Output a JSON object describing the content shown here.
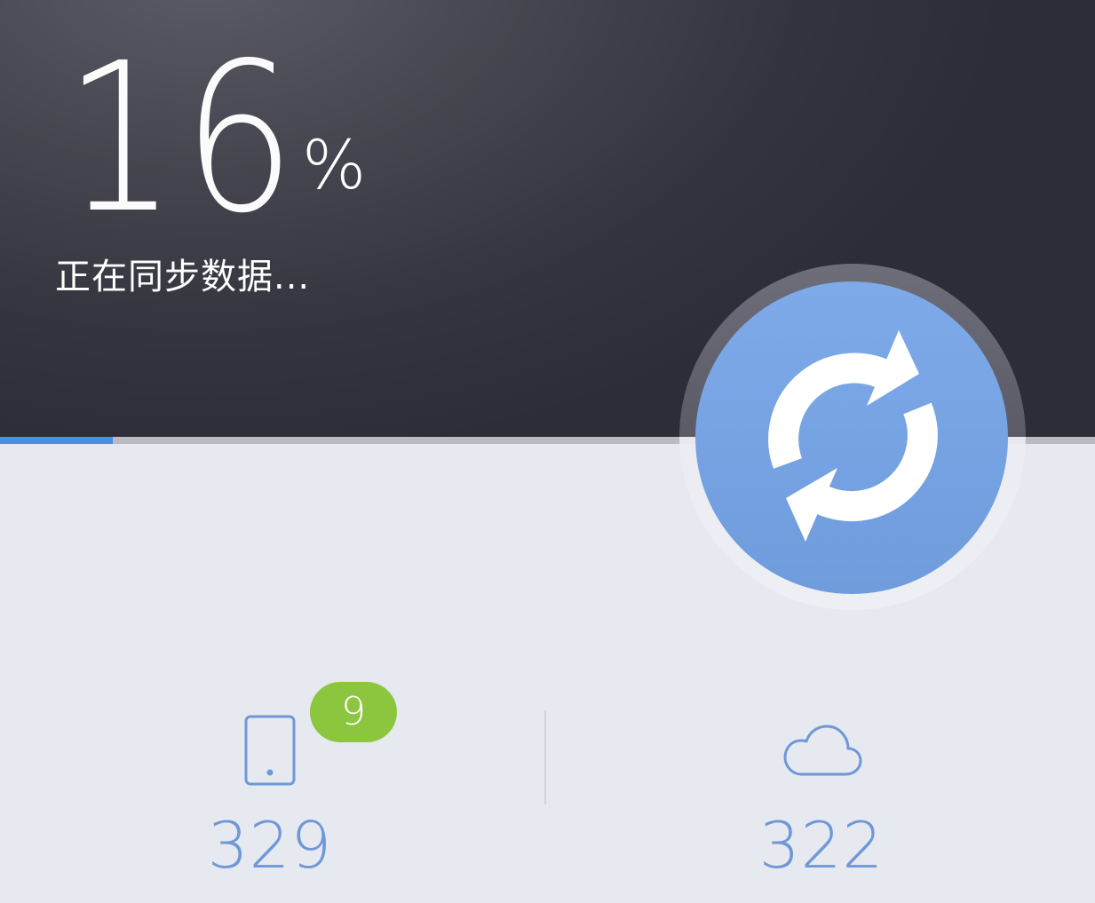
{
  "sync": {
    "percent": "16",
    "percent_sign": "%",
    "status": "正在同步数据...",
    "progress": 0.103
  },
  "stats": {
    "local_badge": "9",
    "local_count": "329",
    "cloud_count": "322"
  },
  "colors": {
    "accent": "#4a8eea",
    "button": "#75a2e2",
    "badge": "#8cc63f",
    "count_text": "#6e98d6",
    "header_bg": "#33343e",
    "body_bg": "#e7e9f0"
  },
  "icons": {
    "sync": "sync-arrows-icon",
    "device": "phone-icon",
    "cloud": "cloud-icon"
  }
}
